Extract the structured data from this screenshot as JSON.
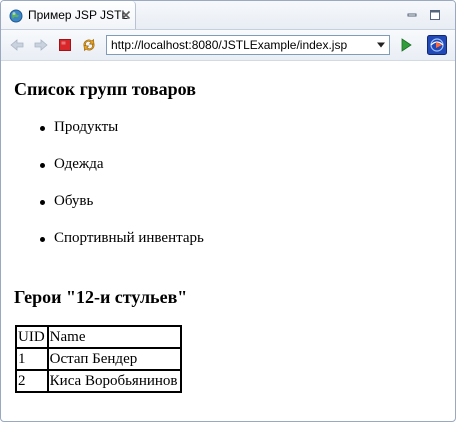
{
  "browser": {
    "tab_title": "Пример JSP JSTL",
    "url": "http://localhost:8080/JSTLExample/index.jsp",
    "icons": {
      "tab": "globe-icon",
      "close": "close-icon",
      "minimize": "minimize-icon",
      "maximize": "maximize-icon",
      "back": "back-arrow-icon",
      "forward": "forward-arrow-icon",
      "stop": "stop-icon",
      "refresh": "refresh-icon",
      "url_dropdown": "chevron-down-icon",
      "go": "go-icon",
      "external": "external-browser-icon"
    },
    "colors": {
      "stop": "#d9262a",
      "go": "#2f9e3a",
      "external": "#2249b5"
    }
  },
  "page": {
    "groups_heading": "Список групп товаров",
    "groups": [
      "Продукты",
      "Одежда",
      "Обувь",
      "Спортивный инвентарь"
    ],
    "heroes_heading": "Герои \"12-и стульев\"",
    "table": {
      "headers": [
        "UID",
        "Name"
      ],
      "rows": [
        [
          "1",
          "Остап Бендер"
        ],
        [
          "2",
          "Киса Воробьянинов"
        ]
      ]
    }
  }
}
